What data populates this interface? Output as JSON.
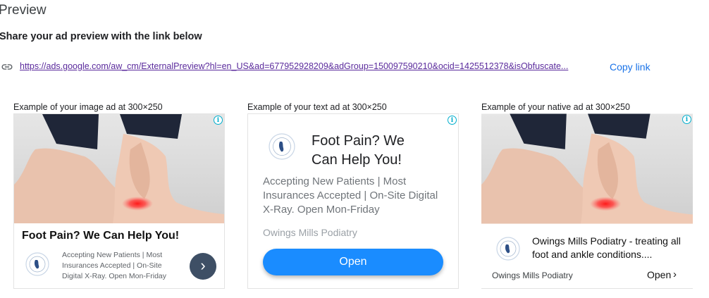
{
  "header": {
    "title": "Preview",
    "subtitle": "Share your ad preview with the link below"
  },
  "link": {
    "icon": "link-icon",
    "url": "https://ads.google.com/aw_cm/ExternalPreview?hl=en_US&ad=677952928209&adGroup=150097590210&ocid=1425512378&isObfuscate...",
    "copy_label": "Copy link"
  },
  "image_ad": {
    "label": "Example of your image ad at 300×250",
    "headline": "Foot Pain? We Can Help You!",
    "body": "Accepting New Patients | Most Insurances Accepted | On-Site Digital X-Ray. Open Mon-Friday",
    "arrow": "›"
  },
  "text_ad": {
    "label": "Example of your text ad at 300×250",
    "headline": "Foot Pain? We Can Help You!",
    "body": "Accepting New Patients | Most Insurances Accepted | On-Site Digital X-Ray. Open Mon-Friday",
    "advertiser": "Owings Mills Podiatry",
    "button": "Open"
  },
  "native_ad": {
    "label": "Example of your native ad at 300×250",
    "headline": "Owings Mills Podiatry - treating all foot and ankle conditions....",
    "advertiser": "Owings Mills Podiatry",
    "open_label": "Open",
    "chevron": "›"
  },
  "info_glyph": "i",
  "colors": {
    "link_blue": "#1a73e8",
    "url_purple": "#5a2a9c",
    "button_blue": "#1a8cff",
    "arrow_circle": "#3e4f65",
    "info_cyan": "#00aecd"
  }
}
